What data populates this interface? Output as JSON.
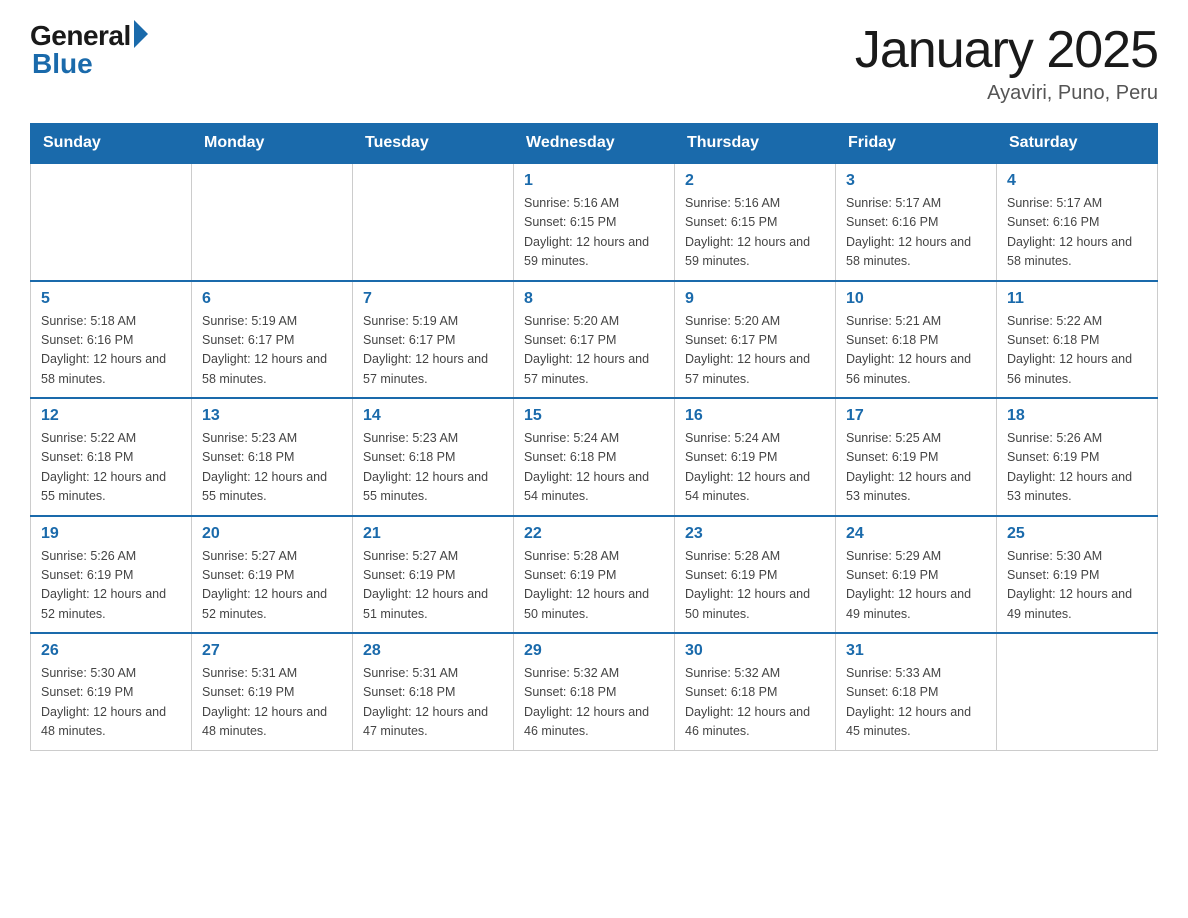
{
  "header": {
    "logo_general": "General",
    "logo_blue": "Blue",
    "title": "January 2025",
    "subtitle": "Ayaviri, Puno, Peru"
  },
  "days_of_week": [
    "Sunday",
    "Monday",
    "Tuesday",
    "Wednesday",
    "Thursday",
    "Friday",
    "Saturday"
  ],
  "weeks": [
    [
      {
        "day": "",
        "info": ""
      },
      {
        "day": "",
        "info": ""
      },
      {
        "day": "",
        "info": ""
      },
      {
        "day": "1",
        "info": "Sunrise: 5:16 AM\nSunset: 6:15 PM\nDaylight: 12 hours\nand 59 minutes."
      },
      {
        "day": "2",
        "info": "Sunrise: 5:16 AM\nSunset: 6:15 PM\nDaylight: 12 hours\nand 59 minutes."
      },
      {
        "day": "3",
        "info": "Sunrise: 5:17 AM\nSunset: 6:16 PM\nDaylight: 12 hours\nand 58 minutes."
      },
      {
        "day": "4",
        "info": "Sunrise: 5:17 AM\nSunset: 6:16 PM\nDaylight: 12 hours\nand 58 minutes."
      }
    ],
    [
      {
        "day": "5",
        "info": "Sunrise: 5:18 AM\nSunset: 6:16 PM\nDaylight: 12 hours\nand 58 minutes."
      },
      {
        "day": "6",
        "info": "Sunrise: 5:19 AM\nSunset: 6:17 PM\nDaylight: 12 hours\nand 58 minutes."
      },
      {
        "day": "7",
        "info": "Sunrise: 5:19 AM\nSunset: 6:17 PM\nDaylight: 12 hours\nand 57 minutes."
      },
      {
        "day": "8",
        "info": "Sunrise: 5:20 AM\nSunset: 6:17 PM\nDaylight: 12 hours\nand 57 minutes."
      },
      {
        "day": "9",
        "info": "Sunrise: 5:20 AM\nSunset: 6:17 PM\nDaylight: 12 hours\nand 57 minutes."
      },
      {
        "day": "10",
        "info": "Sunrise: 5:21 AM\nSunset: 6:18 PM\nDaylight: 12 hours\nand 56 minutes."
      },
      {
        "day": "11",
        "info": "Sunrise: 5:22 AM\nSunset: 6:18 PM\nDaylight: 12 hours\nand 56 minutes."
      }
    ],
    [
      {
        "day": "12",
        "info": "Sunrise: 5:22 AM\nSunset: 6:18 PM\nDaylight: 12 hours\nand 55 minutes."
      },
      {
        "day": "13",
        "info": "Sunrise: 5:23 AM\nSunset: 6:18 PM\nDaylight: 12 hours\nand 55 minutes."
      },
      {
        "day": "14",
        "info": "Sunrise: 5:23 AM\nSunset: 6:18 PM\nDaylight: 12 hours\nand 55 minutes."
      },
      {
        "day": "15",
        "info": "Sunrise: 5:24 AM\nSunset: 6:18 PM\nDaylight: 12 hours\nand 54 minutes."
      },
      {
        "day": "16",
        "info": "Sunrise: 5:24 AM\nSunset: 6:19 PM\nDaylight: 12 hours\nand 54 minutes."
      },
      {
        "day": "17",
        "info": "Sunrise: 5:25 AM\nSunset: 6:19 PM\nDaylight: 12 hours\nand 53 minutes."
      },
      {
        "day": "18",
        "info": "Sunrise: 5:26 AM\nSunset: 6:19 PM\nDaylight: 12 hours\nand 53 minutes."
      }
    ],
    [
      {
        "day": "19",
        "info": "Sunrise: 5:26 AM\nSunset: 6:19 PM\nDaylight: 12 hours\nand 52 minutes."
      },
      {
        "day": "20",
        "info": "Sunrise: 5:27 AM\nSunset: 6:19 PM\nDaylight: 12 hours\nand 52 minutes."
      },
      {
        "day": "21",
        "info": "Sunrise: 5:27 AM\nSunset: 6:19 PM\nDaylight: 12 hours\nand 51 minutes."
      },
      {
        "day": "22",
        "info": "Sunrise: 5:28 AM\nSunset: 6:19 PM\nDaylight: 12 hours\nand 50 minutes."
      },
      {
        "day": "23",
        "info": "Sunrise: 5:28 AM\nSunset: 6:19 PM\nDaylight: 12 hours\nand 50 minutes."
      },
      {
        "day": "24",
        "info": "Sunrise: 5:29 AM\nSunset: 6:19 PM\nDaylight: 12 hours\nand 49 minutes."
      },
      {
        "day": "25",
        "info": "Sunrise: 5:30 AM\nSunset: 6:19 PM\nDaylight: 12 hours\nand 49 minutes."
      }
    ],
    [
      {
        "day": "26",
        "info": "Sunrise: 5:30 AM\nSunset: 6:19 PM\nDaylight: 12 hours\nand 48 minutes."
      },
      {
        "day": "27",
        "info": "Sunrise: 5:31 AM\nSunset: 6:19 PM\nDaylight: 12 hours\nand 48 minutes."
      },
      {
        "day": "28",
        "info": "Sunrise: 5:31 AM\nSunset: 6:18 PM\nDaylight: 12 hours\nand 47 minutes."
      },
      {
        "day": "29",
        "info": "Sunrise: 5:32 AM\nSunset: 6:18 PM\nDaylight: 12 hours\nand 46 minutes."
      },
      {
        "day": "30",
        "info": "Sunrise: 5:32 AM\nSunset: 6:18 PM\nDaylight: 12 hours\nand 46 minutes."
      },
      {
        "day": "31",
        "info": "Sunrise: 5:33 AM\nSunset: 6:18 PM\nDaylight: 12 hours\nand 45 minutes."
      },
      {
        "day": "",
        "info": ""
      }
    ]
  ]
}
